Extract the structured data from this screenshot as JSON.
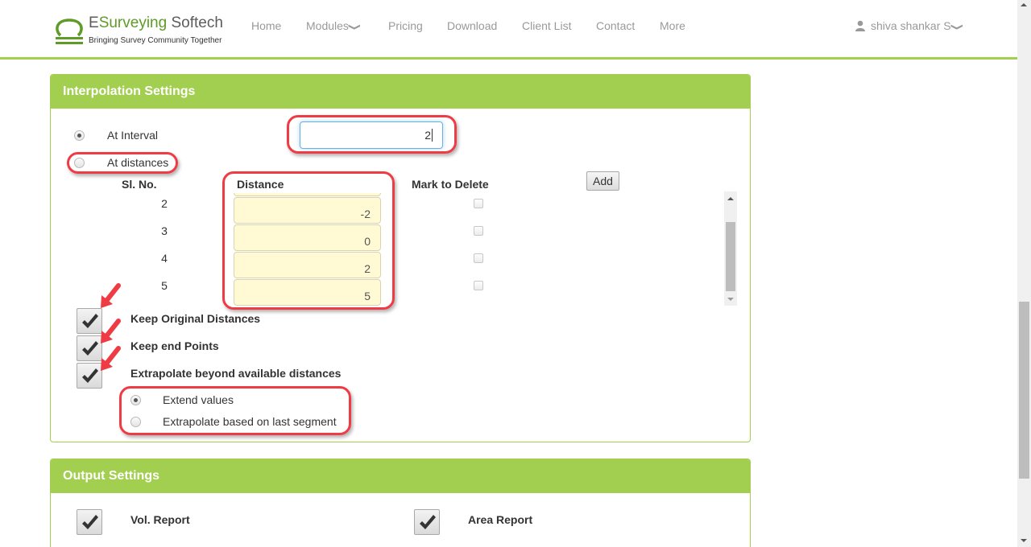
{
  "brand": {
    "title_part1": "E",
    "title_part2": "Surveying",
    "title_part3": " Softech",
    "tagline": "Bringing Survey Community Together",
    "accent_color": "#a2cf4f"
  },
  "nav": {
    "items": [
      {
        "label": "Home"
      },
      {
        "label": "Modules",
        "dropdown": true
      },
      {
        "label": "Pricing"
      },
      {
        "label": "Download"
      },
      {
        "label": "Client List"
      },
      {
        "label": "Contact"
      },
      {
        "label": "More"
      }
    ],
    "user_name": "shiva shankar S"
  },
  "interpolation": {
    "title": "Interpolation Settings",
    "mode_options": [
      {
        "label": "At Interval",
        "selected": true
      },
      {
        "label": "At distances",
        "selected": false
      }
    ],
    "interval_value": "2",
    "add_label": "Add",
    "table": {
      "headers": {
        "sl_no": "Sl. No.",
        "distance": "Distance",
        "mark_delete": "Mark to Delete"
      },
      "rows": [
        {
          "sl_no": "2",
          "distance": "-2",
          "delete": false
        },
        {
          "sl_no": "3",
          "distance": "0",
          "delete": false
        },
        {
          "sl_no": "4",
          "distance": "2",
          "delete": false
        },
        {
          "sl_no": "5",
          "distance": "5",
          "delete": false
        }
      ]
    },
    "options": [
      {
        "label": "Keep Original Distances",
        "checked": true
      },
      {
        "label": "Keep end Points",
        "checked": true
      },
      {
        "label": "Extrapolate beyond available distances",
        "checked": true
      }
    ],
    "extrapolate_modes": [
      {
        "label": "Extend values",
        "selected": true
      },
      {
        "label": "Extrapolate based on last segment",
        "selected": false
      }
    ]
  },
  "output": {
    "title": "Output Settings",
    "options": [
      {
        "label": "Vol. Report",
        "checked": true
      },
      {
        "label": "Area Report",
        "checked": true
      }
    ]
  }
}
